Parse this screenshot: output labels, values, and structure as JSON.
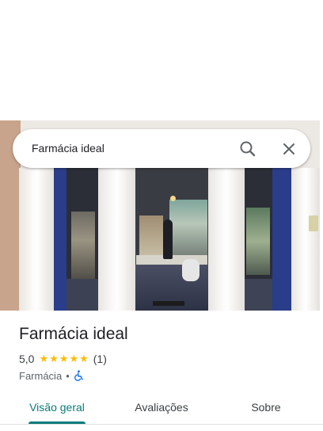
{
  "search": {
    "query": "Farmácia ideal"
  },
  "place": {
    "name": "Farmácia ideal",
    "rating": "5,0",
    "stars": 5,
    "review_count": "(1)",
    "category": "Farmácia",
    "separator": "•",
    "accessibility_icon": "wheelchair-accessible-icon"
  },
  "tabs": [
    {
      "label": "Visão geral",
      "active": true
    },
    {
      "label": "Avaliações",
      "active": false
    },
    {
      "label": "Sobre",
      "active": false
    }
  ],
  "colors": {
    "accent": "#0b7a7a",
    "star": "#fbbc04",
    "wheelchair": "#1a73e8"
  }
}
